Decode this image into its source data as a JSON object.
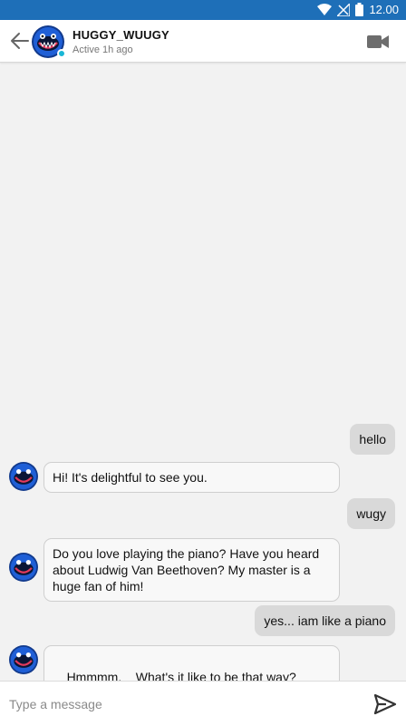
{
  "status_bar": {
    "time": "12.00"
  },
  "header": {
    "contact_name": "HUGGY_WUUGY",
    "contact_status": "Active 1h ago",
    "icons": [
      "back-arrow-icon",
      "video-camera-icon"
    ]
  },
  "messages": [
    {
      "direction": "sent",
      "text": "hello"
    },
    {
      "direction": "received",
      "text": "Hi! It's delightful to see you."
    },
    {
      "direction": "sent",
      "text": "wugy"
    },
    {
      "direction": "received",
      "text": "Do you love playing the piano? Have you heard about Ludwig Van Beethoven? My master is a huge fan of him!"
    },
    {
      "direction": "sent",
      "text": "yes... iam like a piano"
    },
    {
      "direction": "received",
      "text": "Hmmmm.    What's it like to be that way?"
    }
  ],
  "composer": {
    "placeholder": "Type a message",
    "send_icon": "send-icon"
  },
  "colors": {
    "status_bar": "#1e6fb8",
    "online_dot": "#19b7d6",
    "sent_bubble": "#d9d9d9",
    "received_bubble": "#f8f8f8"
  }
}
